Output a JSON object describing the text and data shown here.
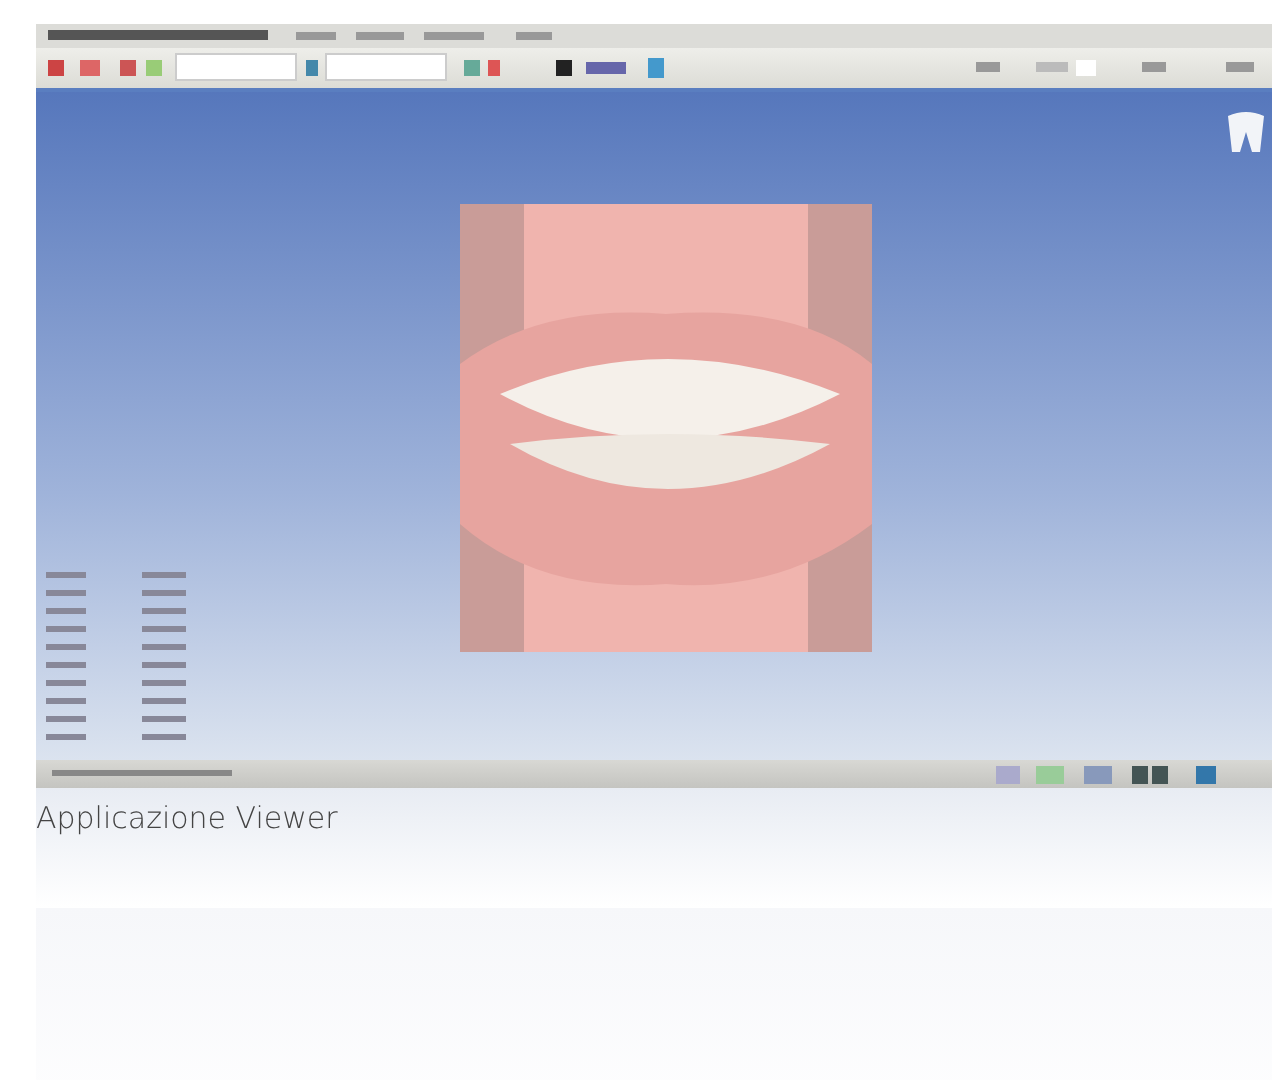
{
  "caption": "Applicazione Viewer"
}
